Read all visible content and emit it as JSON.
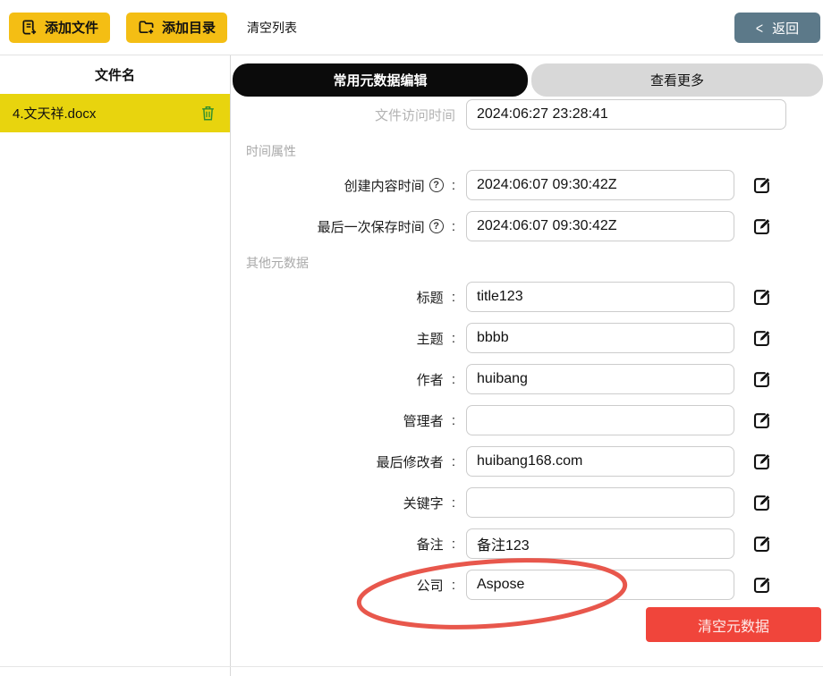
{
  "topbar": {
    "add_file_label": "添加文件",
    "add_dir_label": "添加目录",
    "clear_list_label": "清空列表",
    "back_label": "返回",
    "back_chevron": "<"
  },
  "sidebar": {
    "header": "文件名",
    "files": [
      {
        "name": "4.文天祥.docx",
        "selected": true
      }
    ]
  },
  "tabs": [
    {
      "label": "常用元数据编辑",
      "active": true
    },
    {
      "label": "查看更多",
      "active": false
    }
  ],
  "form": {
    "help_glyph": "?",
    "items": [
      {
        "kind": "field",
        "key": "file-access-time",
        "label": "文件访问时间",
        "colon": "",
        "value": "2024:06:27 23:28:41",
        "muted": true,
        "wide": true,
        "edit": false,
        "help": false
      },
      {
        "kind": "section",
        "label": "时间属性"
      },
      {
        "kind": "field",
        "key": "content-created-time",
        "label": "创建内容时间",
        "help": true,
        "colon": " :",
        "value": "2024:06:07 09:30:42Z",
        "edit": true
      },
      {
        "kind": "field",
        "key": "last-saved-time",
        "label": "最后一次保存时间",
        "help": true,
        "colon": " :",
        "value": "2024:06:07 09:30:42Z",
        "edit": true
      },
      {
        "kind": "section",
        "label": "其他元数据"
      },
      {
        "kind": "field",
        "key": "title",
        "label": "标题",
        "colon": " :",
        "value": "title123",
        "edit": true
      },
      {
        "kind": "field",
        "key": "subject",
        "label": "主题",
        "colon": " :",
        "value": "bbbb",
        "edit": true
      },
      {
        "kind": "field",
        "key": "author",
        "label": "作者",
        "colon": " :",
        "value": "huibang",
        "edit": true
      },
      {
        "kind": "field",
        "key": "manager",
        "label": "管理者",
        "colon": " :",
        "value": "",
        "edit": true
      },
      {
        "kind": "field",
        "key": "last-modified-by",
        "label": "最后修改者",
        "colon": " :",
        "value": "huibang168.com",
        "edit": true
      },
      {
        "kind": "field",
        "key": "keywords",
        "label": "关键字",
        "colon": " :",
        "value": "",
        "edit": true
      },
      {
        "kind": "field",
        "key": "comments",
        "label": "备注",
        "colon": " :",
        "value": "备注123",
        "edit": true
      },
      {
        "kind": "field",
        "key": "company",
        "label": "公司",
        "colon": " :",
        "value": "Aspose",
        "edit": true,
        "circled": true
      }
    ],
    "clear_metadata_label": "清空元数据"
  },
  "annotation": {
    "type": "ellipse",
    "color": "#e8574c"
  },
  "colors": {
    "accent_yellow": "#f4be14",
    "selected_row_yellow": "#e8d40e",
    "tab_active_bg": "#0b0b0b",
    "tab_inactive_bg": "#d8d8d8",
    "back_button_bg": "#5c7989",
    "danger_red": "#f0453b",
    "trash_green": "#2f8f2f",
    "muted_label": "#b3b3b3"
  }
}
